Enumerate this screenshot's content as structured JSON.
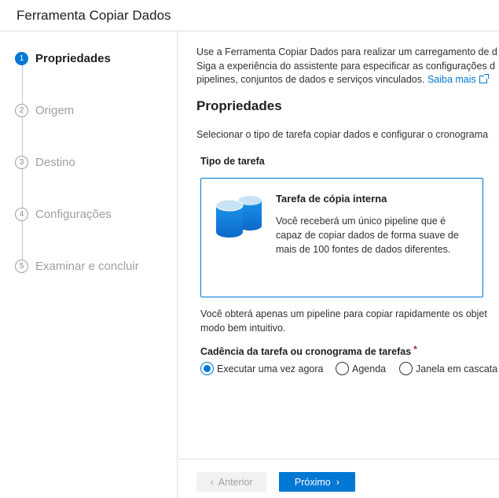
{
  "window": {
    "title": "Ferramenta Copiar Dados"
  },
  "steps": [
    {
      "number": "1",
      "label": "Propriedades",
      "active": true
    },
    {
      "number": "2",
      "label": "Origem",
      "active": false
    },
    {
      "number": "3",
      "label": "Destino",
      "active": false
    },
    {
      "number": "4",
      "label": "Configurações",
      "active": false
    },
    {
      "number": "5",
      "label": "Examinar e concluir",
      "active": false
    }
  ],
  "intro": {
    "line1": "Use a Ferramenta Copiar Dados para realizar um carregamento de d",
    "line2": "Siga a experiência do assistente para especificar as configurações d",
    "line3": "pipelines, conjuntos de dados e serviços vinculados.",
    "link_label": "Saiba mais"
  },
  "properties": {
    "title": "Propriedades",
    "description": "Selecionar o tipo de tarefa copiar dados e configurar o cronograma",
    "task_type_label": "Tipo de tarefa",
    "card": {
      "icon": "database-icon",
      "title": "Tarefa de cópia interna",
      "desc_line1": "Você receberá um único pipeline que é",
      "desc_line2": "capaz de copiar dados de forma suave de",
      "desc_line3": "mais de 100 fontes de dados diferentes."
    },
    "note_line1": "Você obterá apenas um pipeline para copiar rapidamente os objet",
    "note_line2": "modo bem intuitivo.",
    "cadence_label": "Cadência da tarefa ou cronograma de tarefas",
    "required_mark": "*",
    "cadence_options": [
      {
        "label": "Executar uma vez agora",
        "selected": true
      },
      {
        "label": "Agenda",
        "selected": false
      },
      {
        "label": "Janela em cascata",
        "selected": false
      }
    ]
  },
  "footer": {
    "prev_label": "Anterior",
    "next_label": "Próximo",
    "prev_icon": "chevron-left-icon",
    "next_icon": "chevron-right-icon"
  },
  "colors": {
    "accent": "#0078d4",
    "required": "#a4262c",
    "disabled_text": "#a19f9d"
  }
}
